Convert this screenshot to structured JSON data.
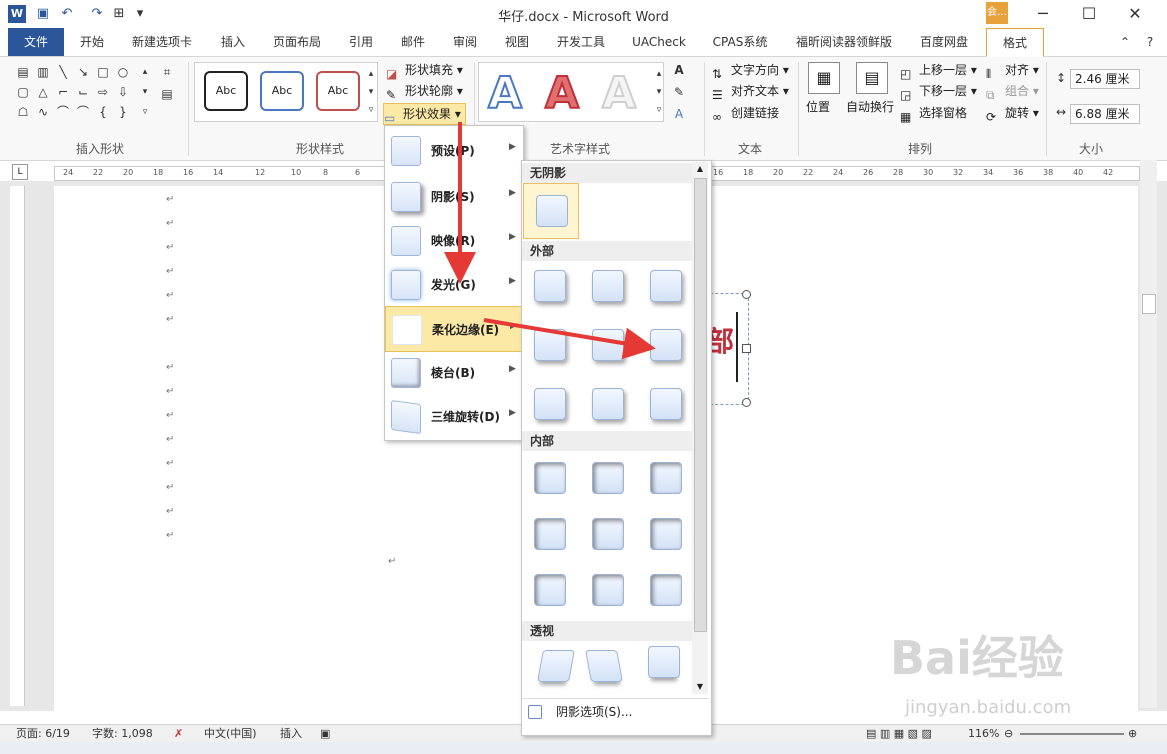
{
  "window": {
    "title": "华仔.docx - Microsoft Word",
    "context_badge": "会…"
  },
  "tabs": [
    {
      "label": "文件"
    },
    {
      "label": "开始"
    },
    {
      "label": "新建选项卡"
    },
    {
      "label": "插入"
    },
    {
      "label": "页面布局"
    },
    {
      "label": "引用"
    },
    {
      "label": "邮件"
    },
    {
      "label": "审阅"
    },
    {
      "label": "视图"
    },
    {
      "label": "开发工具"
    },
    {
      "label": "UACheck"
    },
    {
      "label": "CPAS系统"
    },
    {
      "label": "福昕阅读器领鲜版"
    },
    {
      "label": "百度网盘"
    },
    {
      "label": "格式"
    }
  ],
  "ribbon": {
    "groups": {
      "insert_shapes": "插入形状",
      "shape_styles": "形状样式",
      "wordart_styles": "艺术字样式",
      "text": "文本",
      "arrange": "排列",
      "size": "大小"
    },
    "style_samples": [
      "Abc",
      "Abc",
      "Abc"
    ],
    "shape_fill": "形状填充",
    "shape_outline": "形状轮廓",
    "shape_effects": "形状效果",
    "text_direction": "文字方向",
    "align_text": "对齐文本",
    "create_link": "创建链接",
    "position": "位置",
    "wrap_text": "自动换行",
    "bring_forward": "上移一层",
    "send_backward": "下移一层",
    "selection_pane": "选择窗格",
    "align": "对齐",
    "group": "组合",
    "rotate": "旋转",
    "height_value": "2.46 厘米",
    "width_value": "6.88 厘米",
    "wordart_letter": "A"
  },
  "ruler": {
    "labels": [
      "24",
      "22",
      "20",
      "18",
      "16",
      "14",
      "12",
      "10",
      "8",
      "6",
      "16",
      "18",
      "20",
      "22",
      "24",
      "26",
      "28",
      "30",
      "32",
      "34",
      "36",
      "38",
      "40",
      "42"
    ]
  },
  "document": {
    "textbox_text": "部"
  },
  "effects_menu": {
    "items": [
      {
        "label": "预设(P)"
      },
      {
        "label": "阴影(S)"
      },
      {
        "label": "映像(R)"
      },
      {
        "label": "发光(G)"
      },
      {
        "label": "柔化边缘(E)"
      },
      {
        "label": "棱台(B)"
      },
      {
        "label": "三维旋转(D)"
      }
    ]
  },
  "gallery": {
    "sections": {
      "none": "无阴影",
      "outer": "外部",
      "inner": "内部",
      "perspective": "透视"
    },
    "footer": "阴影选项(S)..."
  },
  "status": {
    "page": "页面: 6/19",
    "words": "字数: 1,098",
    "language": "中文(中国)",
    "mode": "插入",
    "zoom": "116%"
  },
  "watermark": {
    "brand": "Bai经验",
    "url": "jingyan.baidu.com"
  },
  "colors": {
    "file_tab": "#2b579a",
    "context_tab": "#e8a23b",
    "active_menu": "#fde9a6",
    "annotation_arrow": "#e53935"
  }
}
